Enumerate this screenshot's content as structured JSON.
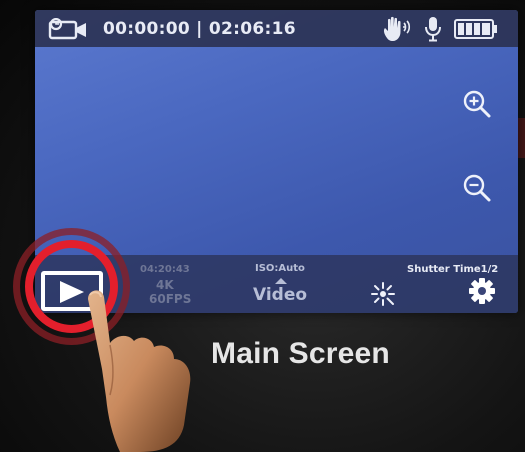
{
  "status_bar": {
    "timecode": "00:00:00 | 02:06:16",
    "icons": [
      "video-camera-icon",
      "gesture-hand-icon",
      "microphone-icon",
      "battery-full-icon"
    ]
  },
  "zoom": {
    "icons": [
      "zoom-in-icon",
      "zoom-out-icon"
    ]
  },
  "bottom_bar": {
    "recording_time": "04:20:43",
    "resolution": "4K",
    "frame_rate": "60FPS",
    "iso": "ISO:Auto",
    "mode": "Video",
    "shutter": "Shutter Time1/2",
    "icons": [
      "play-icon",
      "brightness-icon",
      "settings-gear-icon"
    ]
  },
  "caption": "Main Screen",
  "colors": {
    "screen_blue": "#4a68c0",
    "highlight_red": "#e31f2c",
    "bar_dark": "#2a304e"
  }
}
